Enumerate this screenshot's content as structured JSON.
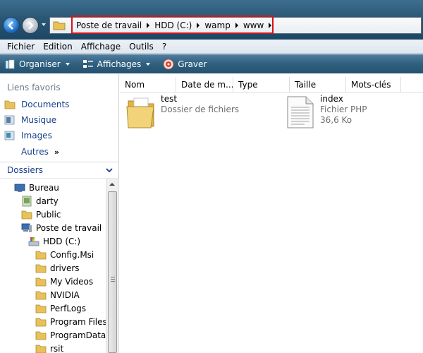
{
  "address": {
    "crumbs": [
      "Poste de travail",
      "HDD (C:)",
      "wamp",
      "www"
    ]
  },
  "menu": [
    "Fichier",
    "Edition",
    "Affichage",
    "Outils",
    "?"
  ],
  "commands": {
    "organiser": "Organiser",
    "affichages": "Affichages",
    "graver": "Graver"
  },
  "favorites": {
    "title": "Liens favoris",
    "items": [
      "Documents",
      "Musique",
      "Images"
    ],
    "more": "Autres",
    "more_chevron": "»"
  },
  "folders": {
    "title": "Dossiers",
    "tree": [
      "Bureau",
      "darty",
      "Public",
      "Poste de travail",
      "HDD (C:)",
      "Config.Msi",
      "drivers",
      "My Videos",
      "NVIDIA",
      "PerfLogs",
      "Program Files",
      "ProgramData",
      "rsit"
    ]
  },
  "columns": [
    "Nom",
    "Date de m...",
    "Type",
    "Taille",
    "Mots-clés"
  ],
  "files": [
    {
      "name": "test",
      "type": "Dossier de fichiers",
      "size": ""
    },
    {
      "name": "index",
      "type": "Fichier PHP",
      "size": "36,6 Ko"
    }
  ],
  "colors": {
    "highlight": "#d4141c",
    "link": "#1a3f8c"
  }
}
